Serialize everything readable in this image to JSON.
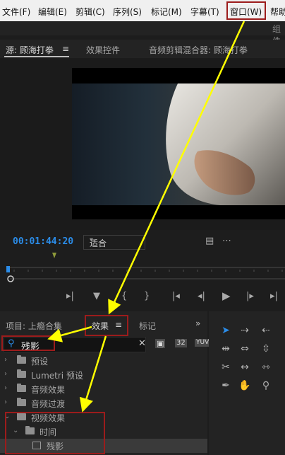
{
  "menubar": {
    "items": [
      "文件(F)",
      "编辑(E)",
      "剪辑(C)",
      "序列(S)",
      "标记(M)",
      "字幕(T)",
      "窗口(W)",
      "帮助"
    ]
  },
  "subbar": {
    "workspace": "组件"
  },
  "source_panel": {
    "tabs": [
      "源: 顾海打拳",
      "效果控件",
      "音频剪辑混合器: 顾海打拳"
    ],
    "menu_icon": "hamburger-icon"
  },
  "player": {
    "timecode": "00:01:44:20",
    "fit": "适合"
  },
  "project_panel": {
    "tabs": [
      "项目: 上瘾合集",
      "效果",
      "标记"
    ],
    "search_value": "残影",
    "toolbar_badges": [
      "32",
      "YUV"
    ]
  },
  "effects_tree": [
    {
      "label": "预设"
    },
    {
      "label": "Lumetri 预设"
    },
    {
      "label": "音频效果"
    },
    {
      "label": "音频过渡"
    },
    {
      "label": "视频效果"
    },
    {
      "label": "时间"
    },
    {
      "label": "残影"
    }
  ],
  "colors": {
    "timecode": "#2b8ce8",
    "highlight_box": "#9c1c1c",
    "arrow": "#ffff00",
    "playhead": "#2b8ce8"
  }
}
